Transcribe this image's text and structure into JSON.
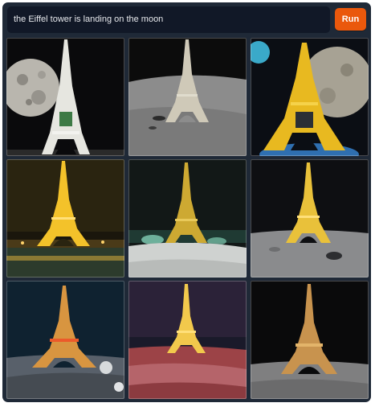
{
  "prompt": {
    "value": "the Eiffel tower is landing on the moon"
  },
  "run_button": {
    "label": "Run"
  },
  "colors": {
    "accent": "#ea580c",
    "panel": "#1f2937",
    "input": "#111827"
  },
  "results": {
    "count": 9,
    "alt": "the Eiffel tower is landing on the moon"
  }
}
